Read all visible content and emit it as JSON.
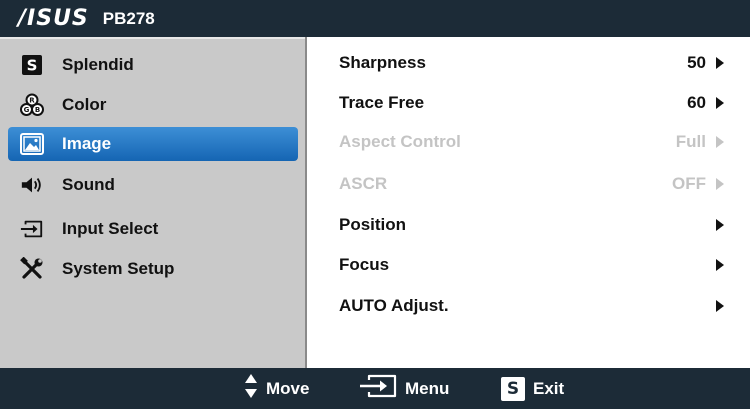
{
  "header": {
    "brand": "/ISUS",
    "model": "PB278"
  },
  "sidebar": {
    "items": [
      {
        "label": "Splendid",
        "icon": "splendid-s-icon"
      },
      {
        "label": "Color",
        "icon": "rgb-circles-icon"
      },
      {
        "label": "Image",
        "icon": "image-icon",
        "active": true
      },
      {
        "label": "Sound",
        "icon": "speaker-icon"
      },
      {
        "label": "Input Select",
        "icon": "input-arrow-icon"
      },
      {
        "label": "System Setup",
        "icon": "tools-icon"
      }
    ]
  },
  "settings": {
    "rows": [
      {
        "label": "Sharpness",
        "value": "50",
        "enabled": true
      },
      {
        "label": "Trace Free",
        "value": "60",
        "enabled": true
      },
      {
        "label": "Aspect Control",
        "value": "Full",
        "enabled": false
      },
      {
        "label": "ASCR",
        "value": "OFF",
        "enabled": false
      },
      {
        "label": "Position",
        "value": "",
        "enabled": true
      },
      {
        "label": "Focus",
        "value": "",
        "enabled": true
      },
      {
        "label": "AUTO Adjust.",
        "value": "",
        "enabled": true
      }
    ]
  },
  "footer": {
    "move_label": "Move",
    "menu_label": "Menu",
    "exit_label": "Exit",
    "exit_key": "S"
  },
  "colors": {
    "frame": "#1c2b37",
    "sidebar_bg": "#c9c9c9",
    "active_item": "#1f6fc0",
    "disabled_text": "#c4c4c4"
  }
}
